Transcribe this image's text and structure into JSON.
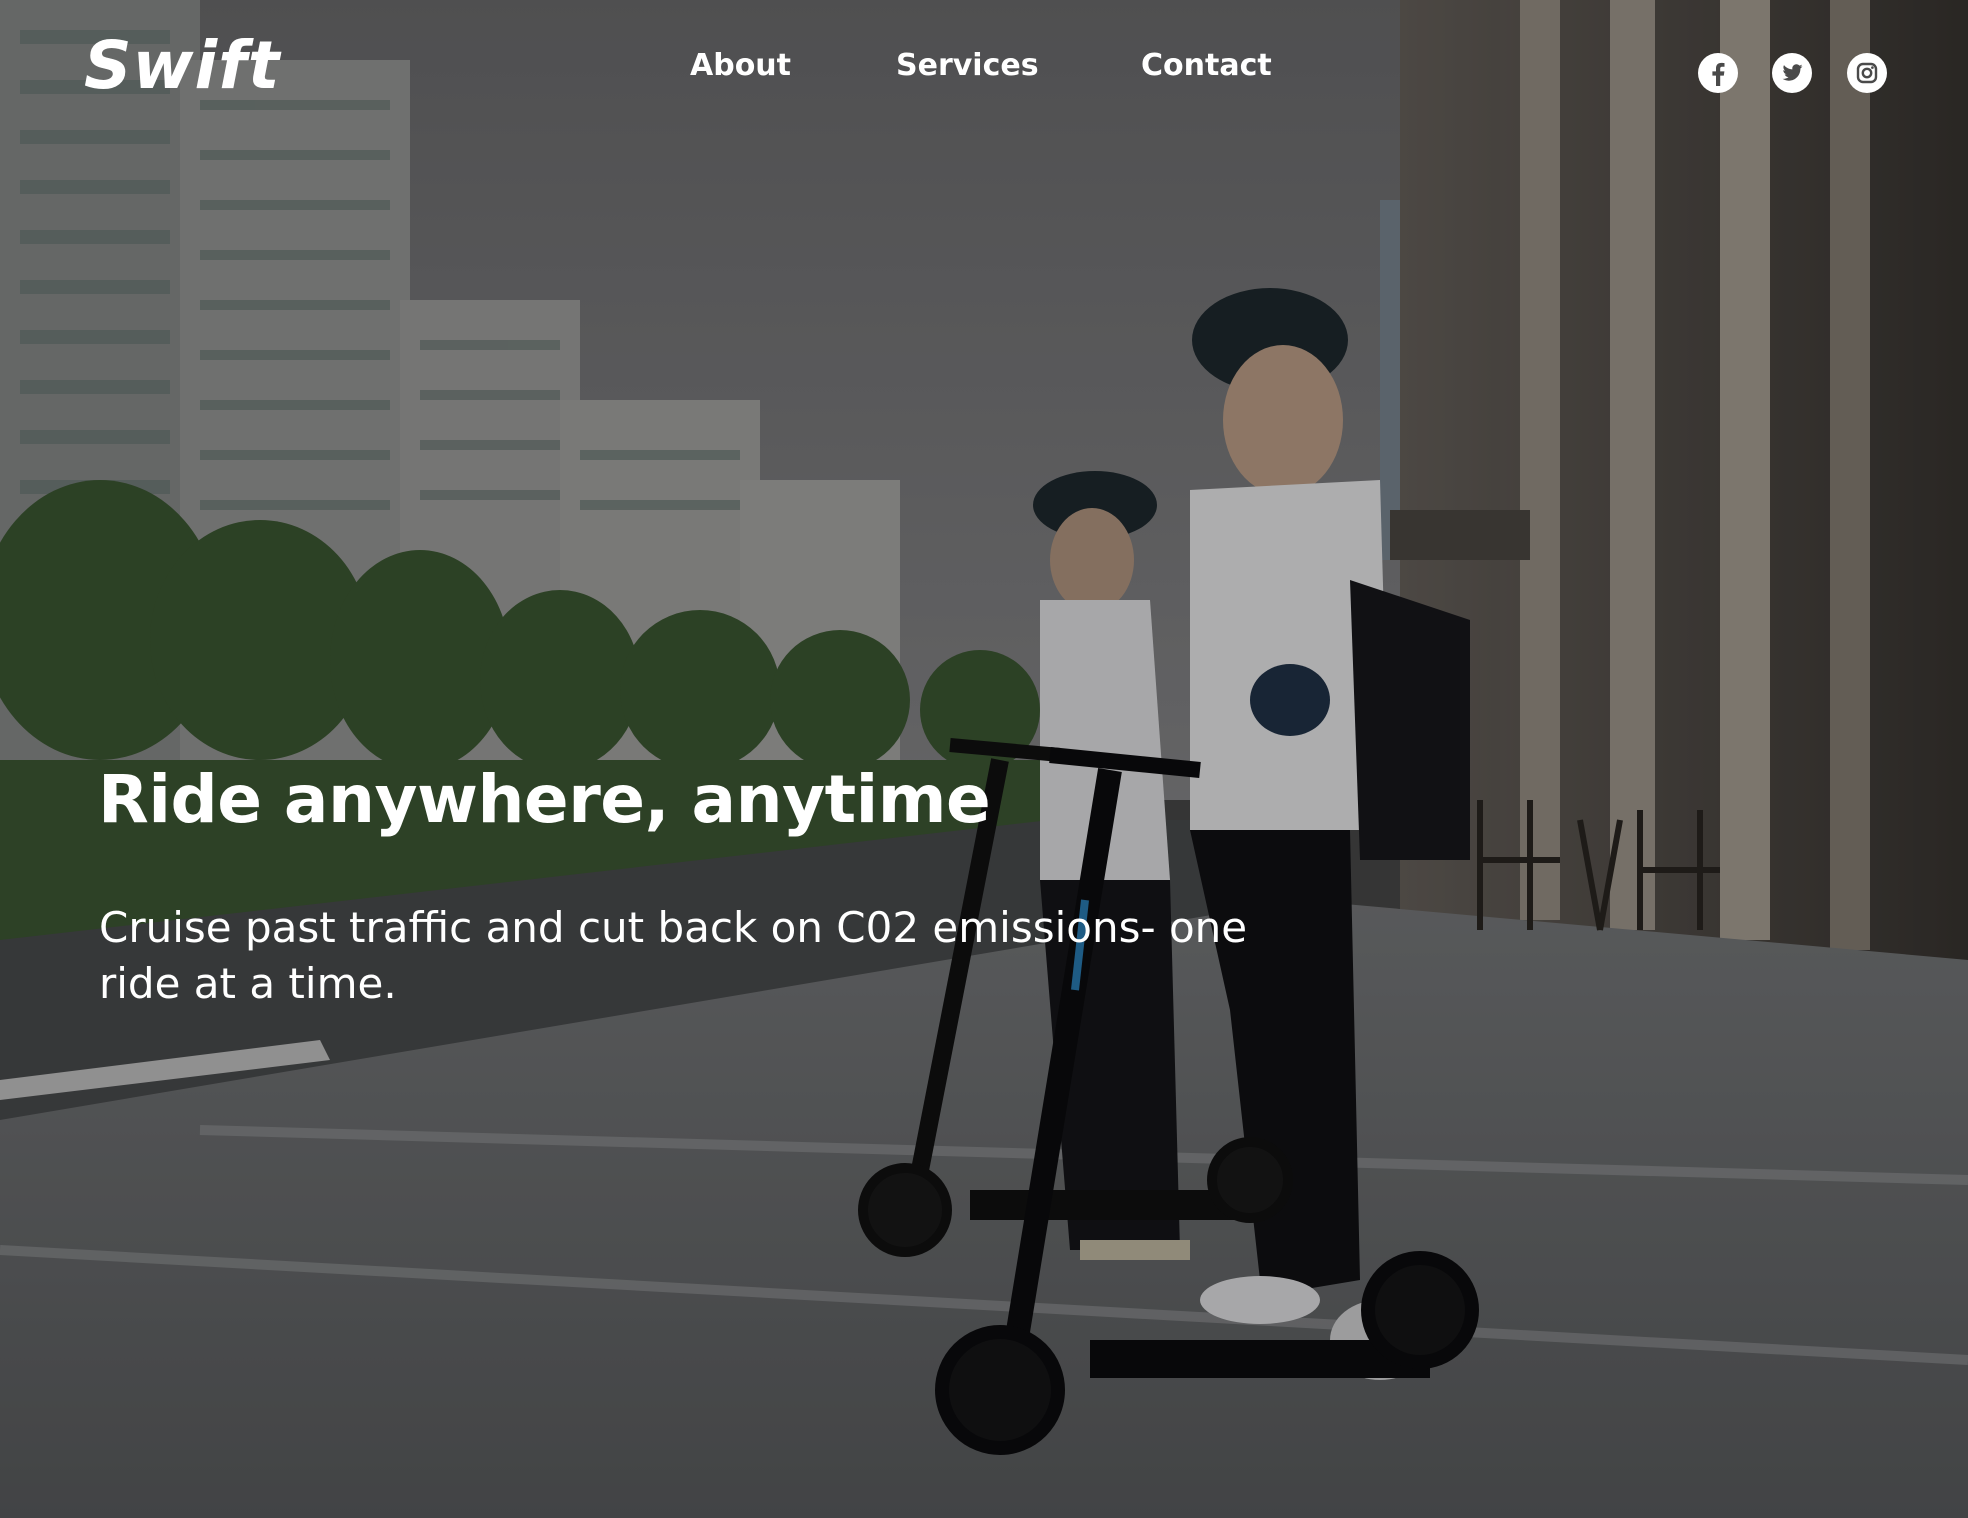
{
  "brand": {
    "logo_text": "Swift"
  },
  "nav": {
    "links": [
      {
        "label": "About"
      },
      {
        "label": "Services"
      },
      {
        "label": "Contact"
      }
    ]
  },
  "social": {
    "icons": [
      "facebook-icon",
      "twitter-icon",
      "instagram-icon"
    ]
  },
  "hero": {
    "headline": "Ride anywhere, anytime",
    "subtext": "Cruise past traffic and cut back on C02 emissions- one ride at a time."
  },
  "colors": {
    "text": "#ffffff",
    "overlay": "#000000"
  }
}
